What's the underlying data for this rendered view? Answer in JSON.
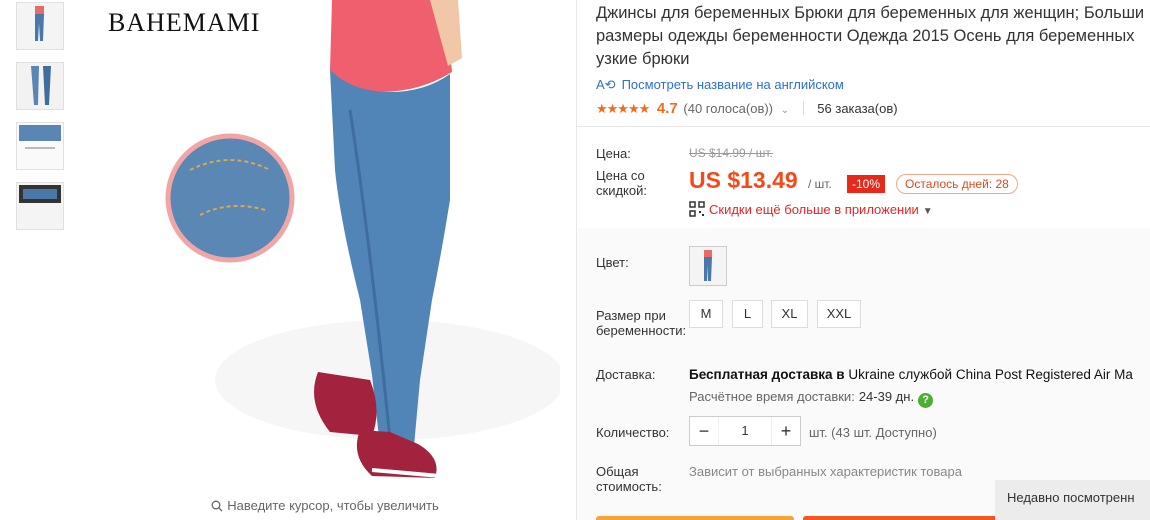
{
  "gallery": {
    "thumbnails": [
      "product-thumb-1",
      "product-thumb-2",
      "product-thumb-3",
      "product-thumb-4"
    ],
    "brand_logo": "BAHEMAMI",
    "zoom_hint": "Наведите курсор, чтобы увеличить"
  },
  "product": {
    "title_lines": [
      "Джинсы для беременных Брюки для беременных для женщин; Больши",
      "размеры одежды беременности Одежда 2015 Осень для беременных",
      "узкие брюки"
    ],
    "translate_link": "Посмотреть название на английском",
    "rating": {
      "stars": "★★★★★",
      "value": "4.7",
      "votes": "(40 голоса(ов))",
      "orders": "56 заказа(ов)"
    }
  },
  "pricing": {
    "price_label": "Цена:",
    "old_price": "US $14.99 / шт.",
    "discount_label": "Цена со скидкой:",
    "current_price": "US $13.49",
    "per_unit": "/ шт.",
    "discount_badge": "-10%",
    "days_left": "Осталось дней: 28",
    "app_promo": "Скидки ещё больше в приложении"
  },
  "options": {
    "color_label": "Цвет:",
    "size_label": "Размер при беременности:",
    "sizes": [
      "M",
      "L",
      "XL",
      "XXL"
    ]
  },
  "shipping": {
    "label": "Доставка:",
    "free_prefix": "Бесплатная доставка в",
    "destination": "Ukraine службой China Post Registered Air Ma",
    "estimate_label": "Расчётное время доставки:",
    "estimate_value": "24-39 дн."
  },
  "quantity": {
    "label": "Количество:",
    "value": "1",
    "available": "шт. (43 шт. Доступно)"
  },
  "total": {
    "label": "Общая стоимость:",
    "note": "Зависит от выбранных характеристик товара"
  },
  "recently_viewed": "Недавно посмотренн",
  "colors": {
    "accent_price": "#f5481b",
    "discount_badge_bg": "#e52a1c",
    "link_blue": "#2e6fd2",
    "star_orange": "#f36c1c",
    "buy_now": "#f5a33a",
    "add_to_cart": "#f0581c"
  }
}
